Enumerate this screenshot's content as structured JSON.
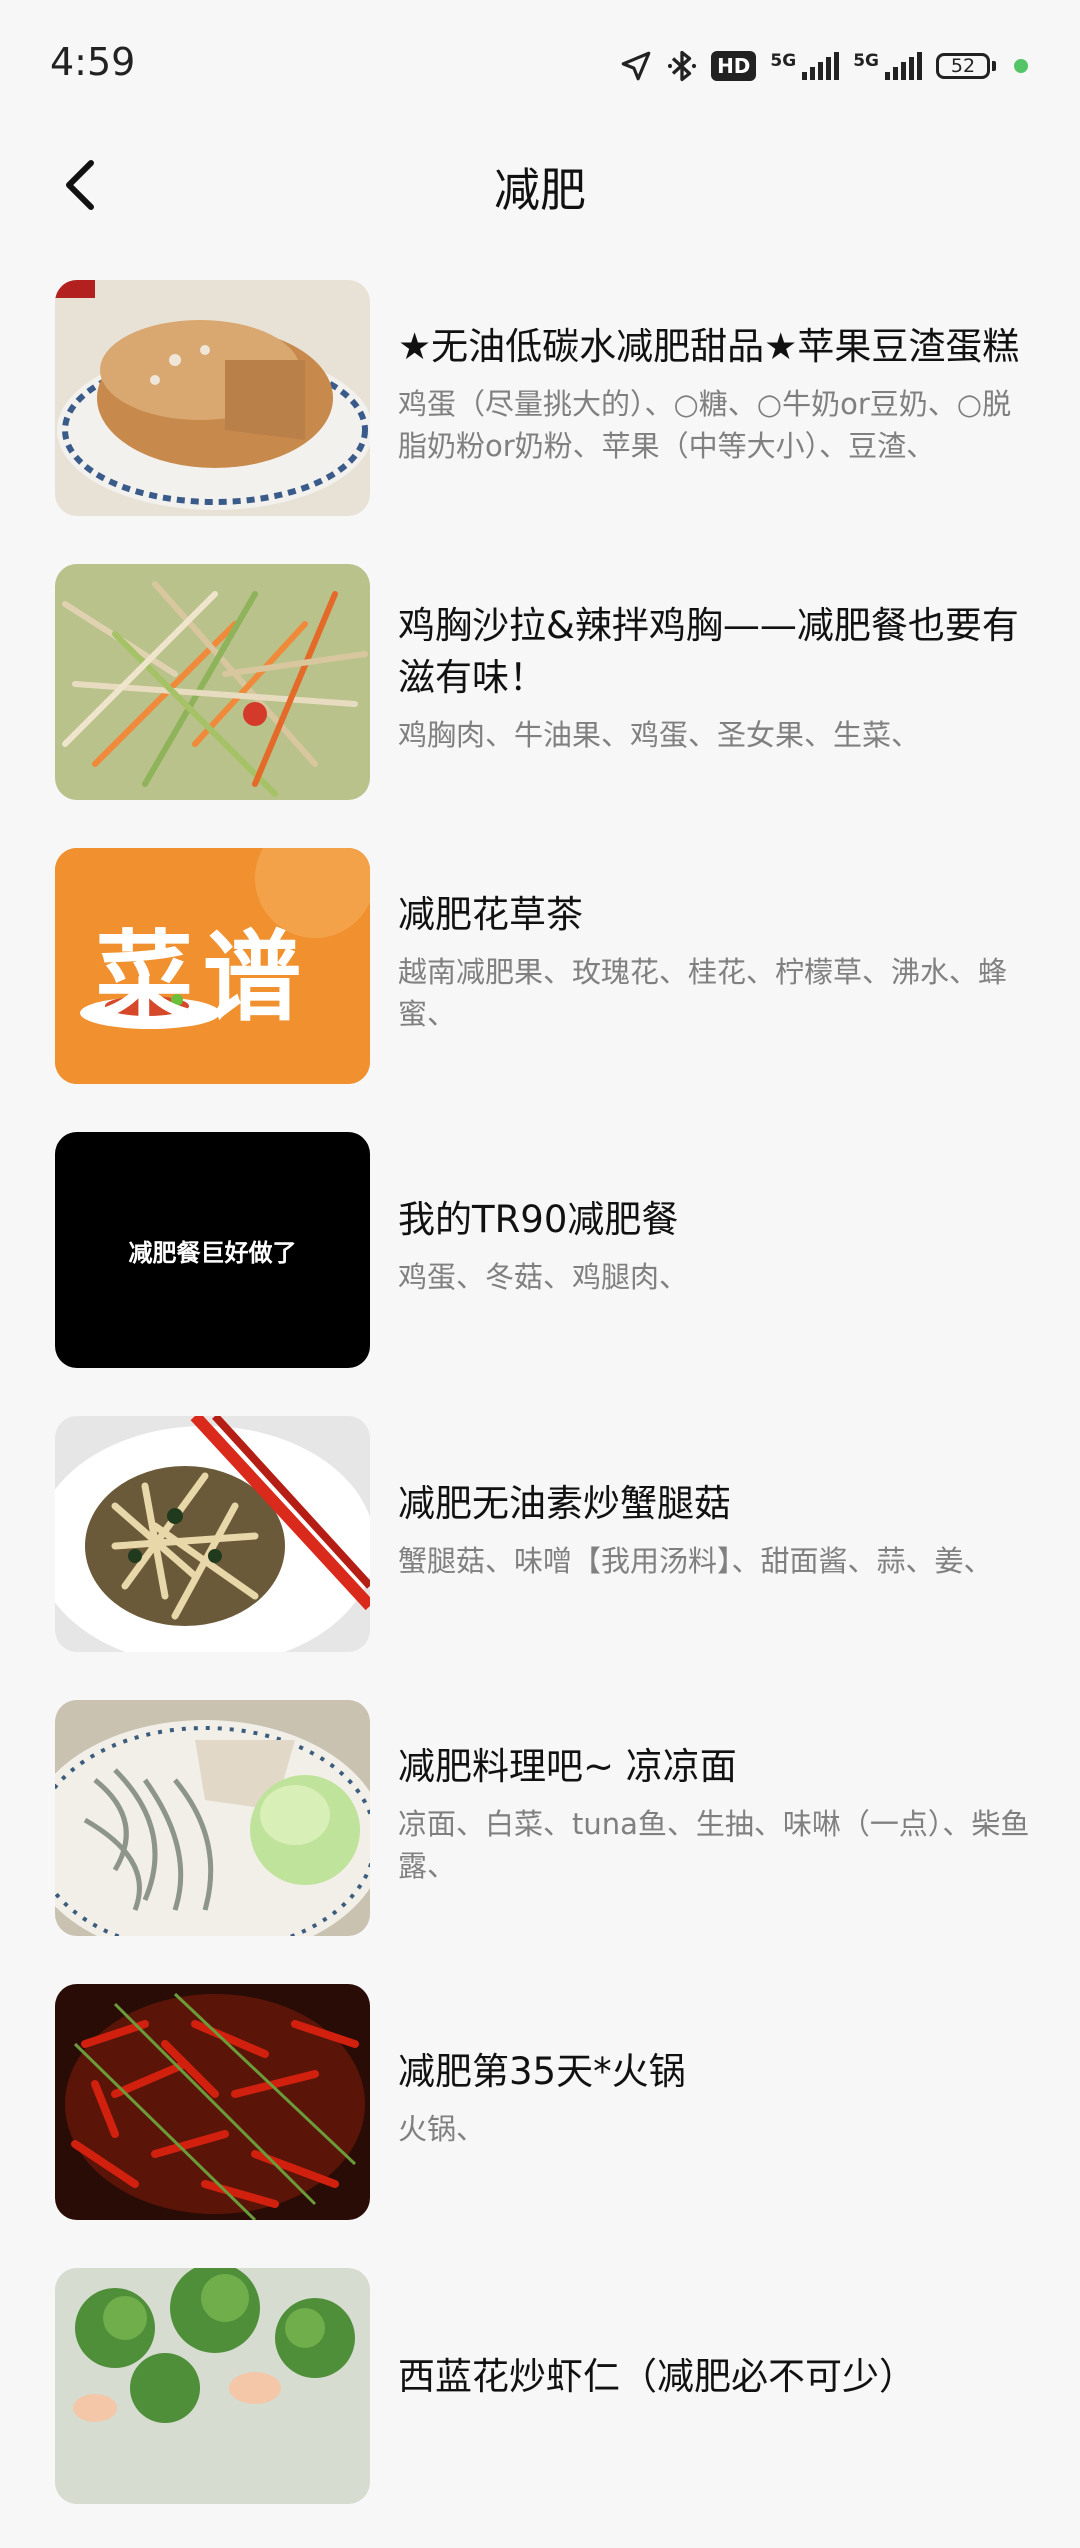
{
  "status_bar": {
    "time": "4:59",
    "icons": [
      "location-icon",
      "bluetooth-icon",
      "hd-icon",
      "signal-5g-icon",
      "signal-5g-icon",
      "battery-icon"
    ],
    "hd_label": "HD",
    "network_label_1": "5G",
    "network_label_2": "5G",
    "battery_level": "52",
    "accent_dot_color": "#55c467"
  },
  "header": {
    "title": "减肥",
    "back_icon": "chevron-left-icon"
  },
  "recipes": [
    {
      "title": "★无油低碳水减肥甜品★苹果豆渣蛋糕",
      "ingredients": "鸡蛋（尽量挑大的）、○糖、○牛奶or豆奶、○脱脂奶粉or奶粉、苹果（中等大小）、豆渣、"
    },
    {
      "title": "鸡胸沙拉&辣拌鸡胸——减肥餐也要有滋有味！",
      "ingredients": "鸡胸肉、牛油果、鸡蛋、圣女果、生菜、"
    },
    {
      "title": "减肥花草茶",
      "ingredients": "越南减肥果、玫瑰花、桂花、柠檬草、沸水、蜂蜜、",
      "thumb_text": "菜谱"
    },
    {
      "title": "我的TR90减肥餐",
      "ingredients": "鸡蛋、冬菇、鸡腿肉、",
      "thumb_text": "减肥餐巨好做了"
    },
    {
      "title": "减肥无油素炒蟹腿菇",
      "ingredients": "蟹腿菇、味噌【我用汤料】、甜面酱、蒜、姜、"
    },
    {
      "title": "减肥料理吧~  凉凉面",
      "ingredients": "凉面、白菜、tuna鱼、生抽、味啉（一点）、柴鱼露、"
    },
    {
      "title": "减肥第35天*火锅",
      "ingredients": "火锅、"
    },
    {
      "title": "西蓝花炒虾仁（减肥必不可少）",
      "ingredients": ""
    }
  ]
}
